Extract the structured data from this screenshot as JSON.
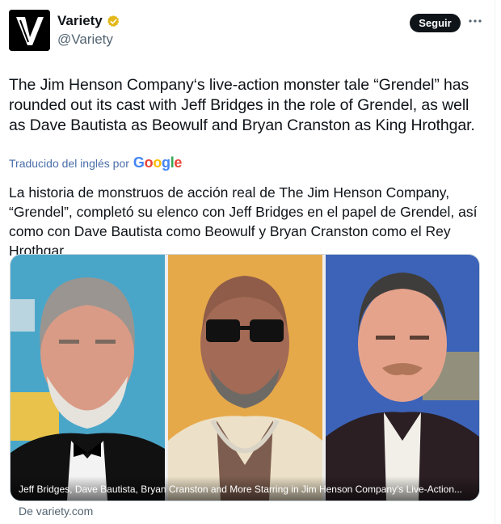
{
  "account": {
    "name": "Variety",
    "handle": "@Variety",
    "avatar_letter": "V"
  },
  "actions": {
    "follow_label": "Seguir"
  },
  "tweet": {
    "text": "The Jim Henson Company‘s live-action monster tale “Grendel” has rounded out its cast with Jeff Bridges in the role of Grendel, as well as Dave Bautista as Beowulf and Bryan Cranston as King Hrothgar."
  },
  "translation": {
    "label": "Traducido del inglés por",
    "provider": "Google",
    "text": "La historia de monstruos de acción real de The Jim Henson Company, “Grendel”, completó su elenco con Jeff Bridges en el papel de Grendel, así como con Dave Bautista como Beowulf y Bryan Cranston como el Rey Hrothgar."
  },
  "link_card": {
    "caption": "Jeff Bridges, Dave Bautista, Bryan Cranston and More Starring in Jim Henson Company's Live-Action...",
    "source": "De variety.com"
  },
  "colors": {
    "accent": "#1d9bf0",
    "verified": "#e2b719",
    "muted": "#536471"
  },
  "icons": [
    "verified-badge-icon",
    "more-options-icon"
  ]
}
